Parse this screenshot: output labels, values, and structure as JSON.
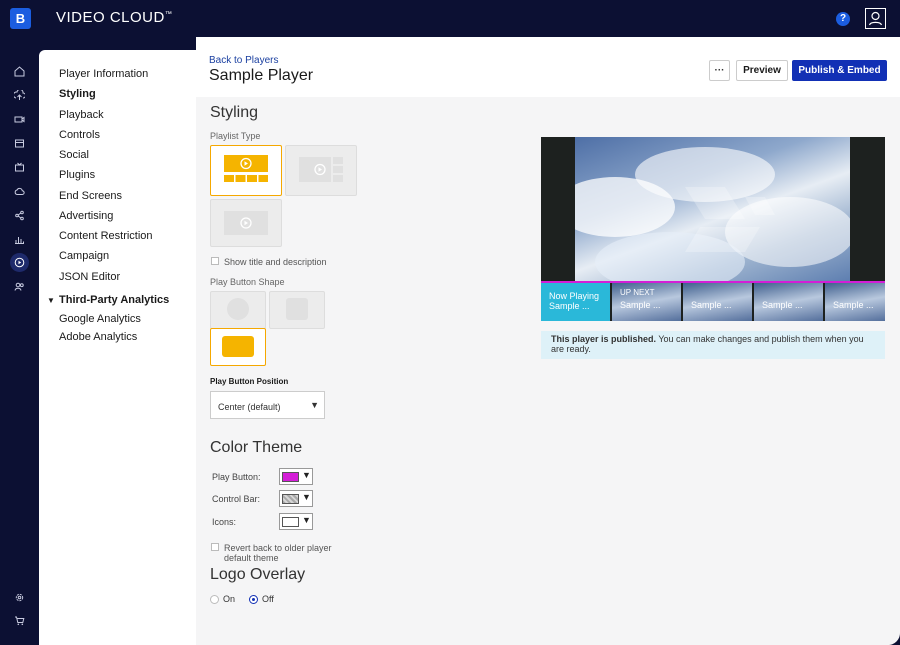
{
  "app": {
    "brand": "VIDEO CLOUD",
    "trademark": "™",
    "logo_glyph": "B",
    "help": "?"
  },
  "rail": {
    "icons": [
      "home-icon",
      "upload-icon",
      "video-icon",
      "media-icon",
      "live-icon",
      "cloud-icon",
      "share-icon",
      "analytics-icon",
      "players-icon",
      "users-icon",
      "settings-icon",
      "cart-icon"
    ],
    "active": "players-icon"
  },
  "nav": {
    "items": [
      "Player Information",
      "Styling",
      "Playback",
      "Controls",
      "Social",
      "Plugins",
      "End Screens",
      "Advertising",
      "Content Restriction",
      "Campaign",
      "JSON Editor"
    ],
    "active": "Styling",
    "section": "Third-Party Analytics",
    "caret": "▼",
    "sub_items": [
      "Google Analytics",
      "Adobe Analytics"
    ]
  },
  "header": {
    "back": "Back to Players",
    "title": "Sample Player",
    "more": "···",
    "preview": "Preview",
    "publish": "Publish & Embed"
  },
  "styling": {
    "heading": "Styling",
    "playlist_type_label": "Playlist Type",
    "show_title": "Show title and description",
    "play_shape_label": "Play Button Shape",
    "play_position_label": "Play Button Position",
    "play_position_value": "Center (default)",
    "select_arrow": "▼"
  },
  "theme": {
    "heading": "Color Theme",
    "play_button_label": "Play Button:",
    "control_bar_label": "Control Bar:",
    "icons_label": "Icons:",
    "play_button_color": "#d41ed7",
    "control_bar_color": "#bdbdbd",
    "icons_color": "#ffffff",
    "arrow": "▼",
    "revert": "Revert back to older player default theme"
  },
  "logo": {
    "heading": "Logo Overlay",
    "on": "On",
    "off": "Off",
    "selected": "Off"
  },
  "player": {
    "thumbs": [
      {
        "top": "Now Playing",
        "bottom": "Sample ..."
      },
      {
        "top": "UP NEXT",
        "bottom": "Sample ..."
      },
      {
        "top": "",
        "bottom": "Sample ..."
      },
      {
        "top": "",
        "bottom": "Sample ..."
      },
      {
        "top": "",
        "bottom": "Sample ..."
      }
    ],
    "notice_bold": "This player is published.",
    "notice_text": " You can make changes and publish them when you are ready."
  },
  "colors": {
    "accent": "#1230b5",
    "selected_border": "#f5a800",
    "tile_fill": "#f5b400",
    "rail_bg": "#0c1033"
  }
}
